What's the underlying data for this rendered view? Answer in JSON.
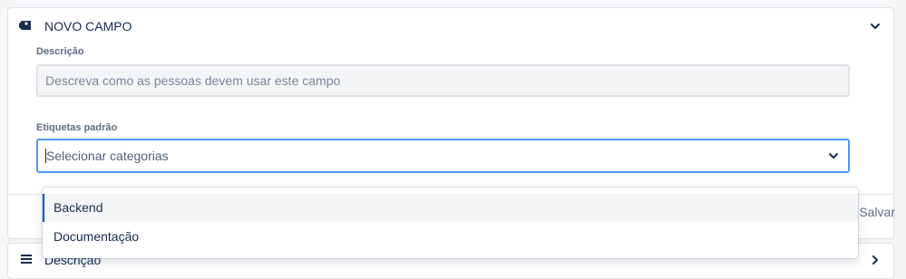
{
  "field_card": {
    "title": "NOVO CAMPO",
    "icon": "tag-icon",
    "collapse_icon": "chevron-down-icon",
    "description": {
      "label": "Descrição",
      "placeholder": "Descreva como as pessoas devem usar este campo",
      "value": ""
    },
    "default_tags": {
      "label": "Etiquetas padrão",
      "placeholder": "Selecionar categorias",
      "dropdown_icon": "chevron-down-icon",
      "options": [
        {
          "label": "Backend",
          "highlighted": true
        },
        {
          "label": "Documentação",
          "highlighted": false
        }
      ]
    },
    "footer": {
      "save_label": "Salvar"
    }
  },
  "next_card": {
    "title": "Descrição",
    "icon": "menu-lines-icon",
    "expand_icon": "chevron-right-icon"
  },
  "colors": {
    "focus_border": "#4c9aff",
    "active_option_bar": "#0052cc",
    "text": "#172b4d",
    "muted_text": "#5e6c84"
  }
}
